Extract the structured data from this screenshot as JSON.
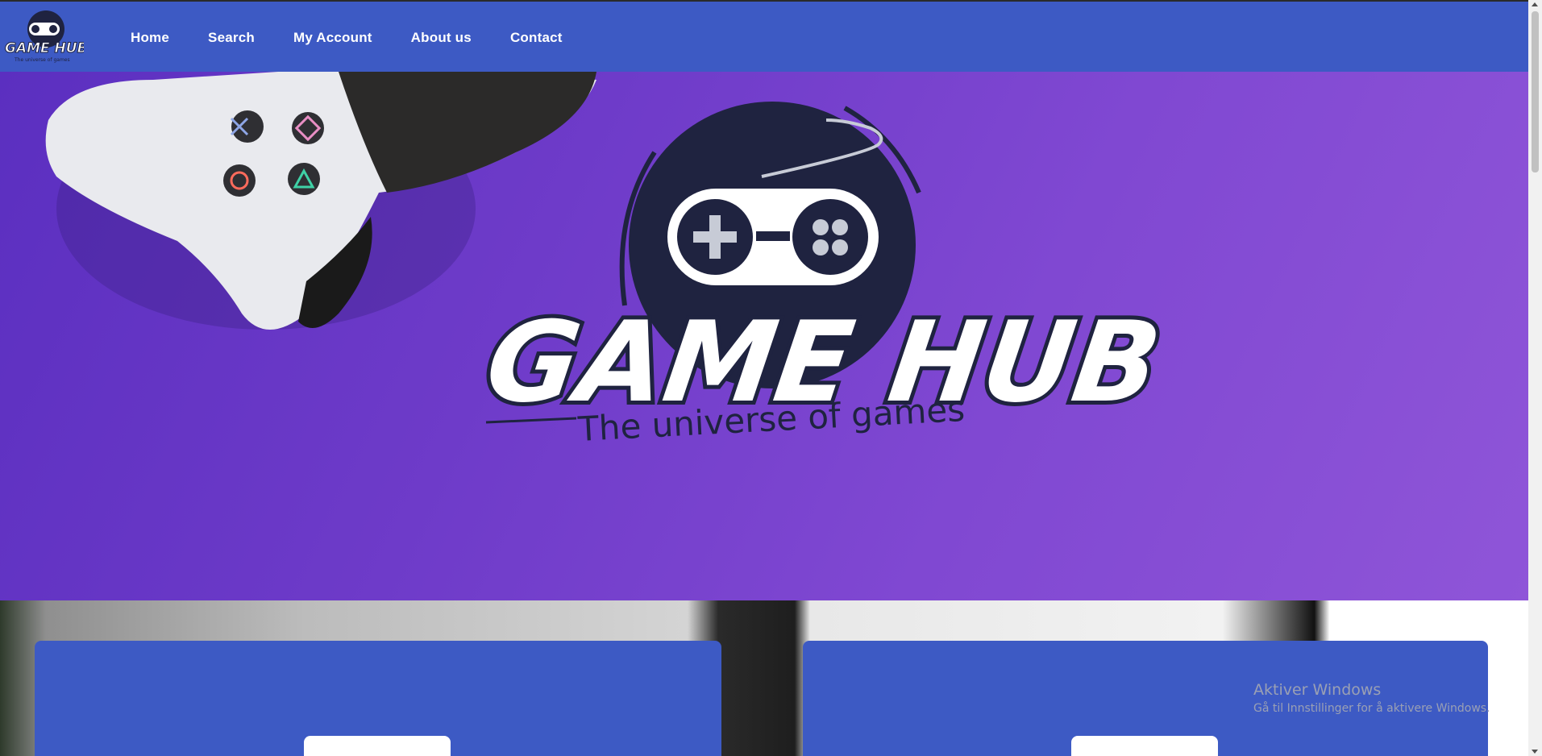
{
  "brand": {
    "name": "GAME HUB",
    "tagline": "The universe of games",
    "colors": {
      "nav": "#3d5ac4",
      "hero": "#7b44cf",
      "logo_dark": "#1f2340"
    }
  },
  "nav": {
    "items": [
      {
        "label": "Home"
      },
      {
        "label": "Search"
      },
      {
        "label": "My Account"
      },
      {
        "label": "About us"
      },
      {
        "label": "Contact"
      }
    ]
  },
  "hero": {
    "logo_title": "GAME HUB",
    "logo_tagline": "The universe of games"
  },
  "watermark": {
    "title": "Aktiver Windows",
    "subtitle": "Gå til Innstillinger for å aktivere Windows."
  },
  "icons": {
    "nav_logo": "game-hub-logo-icon",
    "hero_logo": "game-hub-logo-icon",
    "controller": "gamepad-icon"
  }
}
